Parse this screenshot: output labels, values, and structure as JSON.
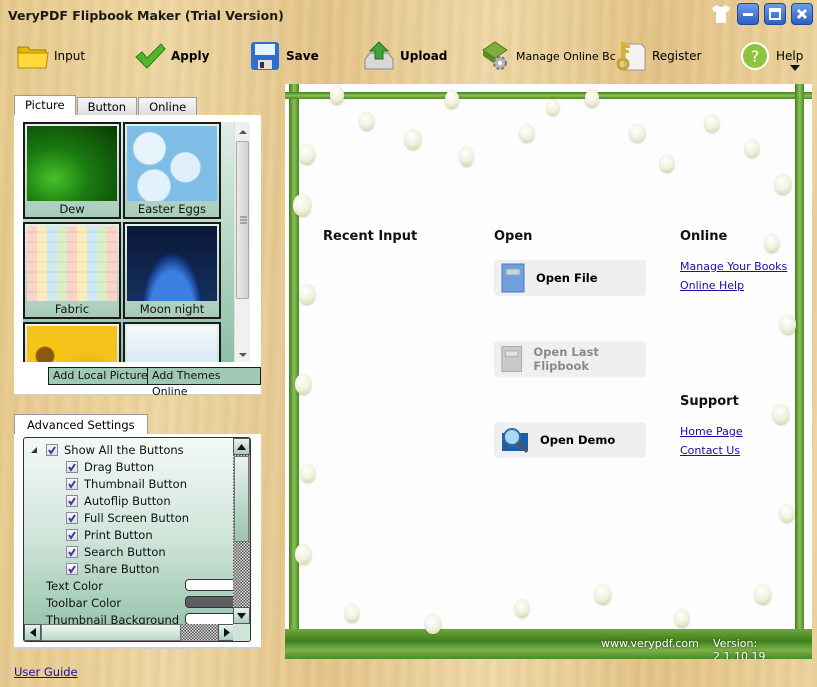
{
  "window": {
    "title": "VeryPDF Flipbook Maker (Trial Version)",
    "controls": [
      "skin",
      "minimize",
      "maximize",
      "close"
    ]
  },
  "toolbar": {
    "items": [
      {
        "label": "Input",
        "icon": "folder-icon",
        "bold": false
      },
      {
        "label": "Apply",
        "icon": "checkmark-icon",
        "bold": true
      },
      {
        "label": "Save",
        "icon": "floppy-disk-icon",
        "bold": true
      },
      {
        "label": "Upload",
        "icon": "upload-icon",
        "bold": true
      },
      {
        "label": "Manage Online Bc",
        "icon": "book-gear-icon",
        "bold": false
      },
      {
        "label": "Register",
        "icon": "key-icon",
        "bold": false
      },
      {
        "label": "Help",
        "icon": "help-icon",
        "bold": false
      }
    ]
  },
  "left_panel": {
    "tabs": [
      {
        "label": "Picture",
        "active": true
      },
      {
        "label": "Button",
        "active": false
      },
      {
        "label": "Online",
        "active": false
      }
    ],
    "themes": [
      {
        "name": "Dew"
      },
      {
        "name": "Easter Eggs"
      },
      {
        "name": "Fabric"
      },
      {
        "name": "Moon night"
      },
      {
        "name": ""
      },
      {
        "name": ""
      }
    ],
    "buttons": {
      "add_local": "Add Local Picture",
      "add_online": "Add Themes Online"
    }
  },
  "advanced": {
    "tab_label": "Advanced Settings",
    "root": {
      "label": "Show All the Buttons",
      "checked": true,
      "expanded": true
    },
    "children": [
      {
        "label": "Drag Button",
        "checked": true
      },
      {
        "label": "Thumbnail Button",
        "checked": true
      },
      {
        "label": "Autoflip Button",
        "checked": true
      },
      {
        "label": "Full Screen Button",
        "checked": true
      },
      {
        "label": "Print Button",
        "checked": true
      },
      {
        "label": "Search Button",
        "checked": true
      },
      {
        "label": "Share Button",
        "checked": true
      }
    ],
    "colors": [
      {
        "label": "Text Color",
        "value": "#ffffff"
      },
      {
        "label": "Toolbar Color",
        "value": "#5f5f63"
      },
      {
        "label": "Thumbnail Background",
        "value": "#ffffff"
      }
    ]
  },
  "user_guide": "User Guide",
  "start_page": {
    "recent_title": "Recent Input",
    "open_title": "Open",
    "open_buttons": [
      {
        "label": "Open File",
        "enabled": true,
        "icon": "book-icon"
      },
      {
        "label": "Open Last Flipbook",
        "enabled": false,
        "icon": "book-icon"
      },
      {
        "label": "Open Demo",
        "enabled": true,
        "icon": "magnifier-icon"
      }
    ],
    "online_title": "Online",
    "online_links": [
      "Manage Your Books",
      "Online Help"
    ],
    "support_title": "Support",
    "support_links": [
      "Home Page",
      "Contact Us"
    ],
    "website": "www.verypdf.com",
    "version": "Version: 2.1.10.19"
  }
}
